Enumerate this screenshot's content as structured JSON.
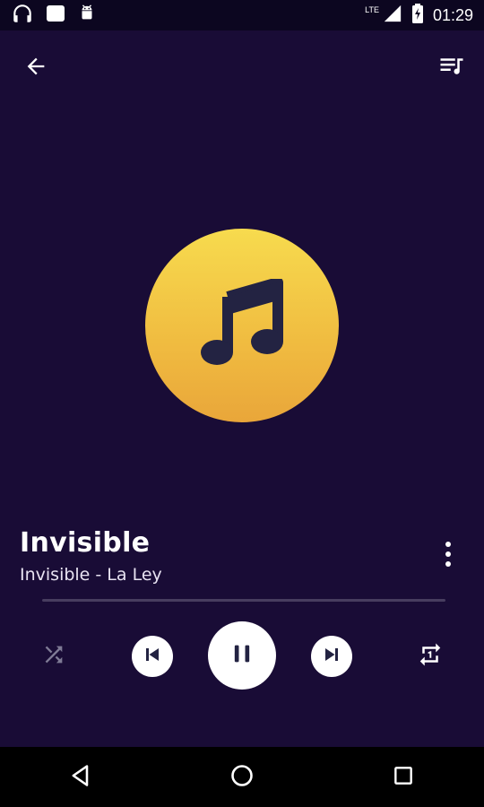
{
  "status_bar": {
    "time": "01:29",
    "network": "LTE",
    "icons": [
      "headphones-icon",
      "square-notification-icon",
      "android-icon",
      "signal-icon",
      "battery-icon"
    ]
  },
  "app_bar": {
    "back_icon": "arrow-back-icon",
    "queue_icon": "queue-music-icon"
  },
  "now_playing": {
    "album_art_icon": "music-note-icon",
    "title": "Invisible",
    "subtitle": "Invisible - La Ley",
    "progress": 0.0
  },
  "controls": {
    "shuffle_icon": "shuffle-icon",
    "prev_icon": "skip-previous-icon",
    "play_pause_icon": "pause-icon",
    "next_icon": "skip-next-icon",
    "repeat_icon": "repeat-one-icon"
  },
  "nav_bar": {
    "back_icon": "triangle-back-icon",
    "home_icon": "circle-home-icon",
    "recents_icon": "square-recents-icon"
  },
  "colors": {
    "background": "#190c36",
    "status_bar": "#0c0620",
    "album_art_top": "#f7db4e",
    "album_art_bottom": "#e9a63a",
    "icon_dark": "#232342"
  }
}
